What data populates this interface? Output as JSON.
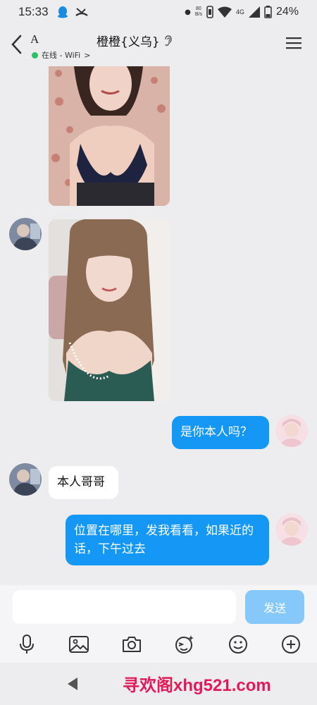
{
  "status": {
    "time": "15:33",
    "net_speed_top": "80",
    "net_speed_bottom": "B/s",
    "signal_label": "4G",
    "battery": "24%"
  },
  "header": {
    "contact_initial": "A",
    "title": "橙橙{义乌}",
    "online_text": "在线 - WiFi",
    "chevron": ">"
  },
  "messages": [
    {
      "type": "image",
      "direction": "in",
      "content": "selfie photo 1"
    },
    {
      "type": "image",
      "direction": "in",
      "content": "selfie photo 2"
    },
    {
      "type": "text",
      "direction": "out",
      "text": "是你本人吗？"
    },
    {
      "type": "text",
      "direction": "in",
      "text": "本人哥哥"
    },
    {
      "type": "text",
      "direction": "out",
      "text": "位置在哪里，发我看看，如果近的话，下午过去"
    }
  ],
  "input": {
    "placeholder": "",
    "send_label": "发送"
  },
  "toolbar": {
    "icons": [
      "mic-icon",
      "image-icon",
      "camera-icon",
      "emoji-gif-icon",
      "emoji-icon",
      "plus-icon"
    ]
  },
  "watermark": "寻欢阁xhg521.com",
  "colors": {
    "accent": "#1597f5",
    "send_disabled": "#85c8f9",
    "online": "#2bc266",
    "watermark": "#e21a5a"
  }
}
